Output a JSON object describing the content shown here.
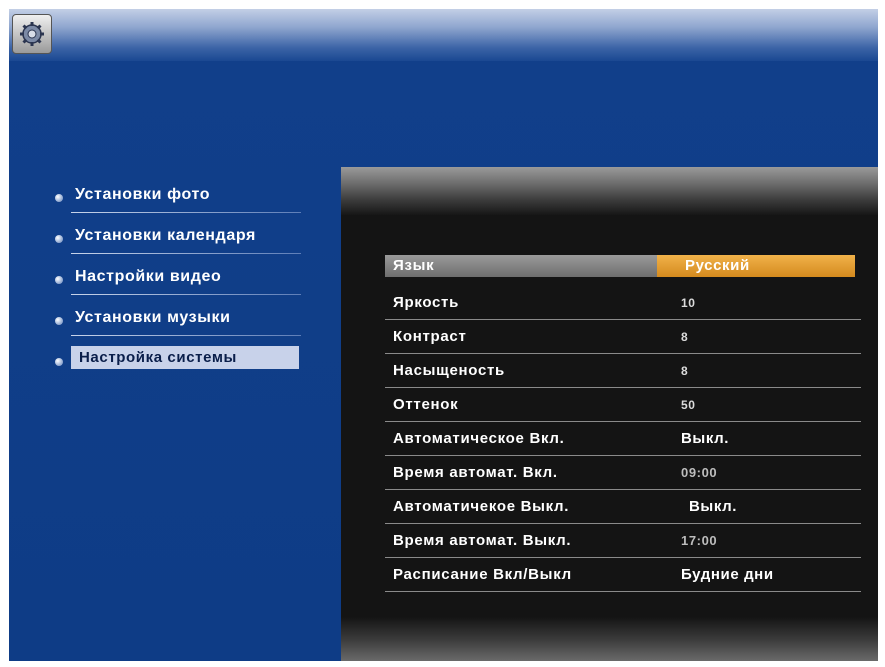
{
  "menu": {
    "items": [
      {
        "label": "Установки фото"
      },
      {
        "label": "Установки календаря"
      },
      {
        "label": "Настройки видео"
      },
      {
        "label": "Установки музыки"
      },
      {
        "label": "Настройка системы",
        "active": true
      }
    ]
  },
  "settings": {
    "rows": [
      {
        "label": "Язык",
        "value": "Русский",
        "selected": true
      },
      {
        "label": "Яркость",
        "value": "10"
      },
      {
        "label": "Контраст",
        "value": "8"
      },
      {
        "label": "Насыщеность",
        "value": "8"
      },
      {
        "label": "Оттенок",
        "value": "50"
      },
      {
        "label": "Автоматическое Вкл.",
        "value": "Выкл."
      },
      {
        "label": "Время автомат. Вкл.",
        "value": "09:00"
      },
      {
        "label": "Автоматичекое Выкл.",
        "value": "Выкл."
      },
      {
        "label": "Время автомат. Выкл.",
        "value": "17:00"
      },
      {
        "label": "Расписание Вкл/Выкл",
        "value": "Будние дни"
      }
    ]
  },
  "colors": {
    "background": "#0e3c86",
    "panel": "#141414",
    "selected_value": "#e39a2c",
    "selected_label": "#8a8a8a",
    "active_menu": "#c8d2ea"
  },
  "icons": {
    "app": "settings-gear-icon",
    "bullet": "round-bullet-icon"
  }
}
